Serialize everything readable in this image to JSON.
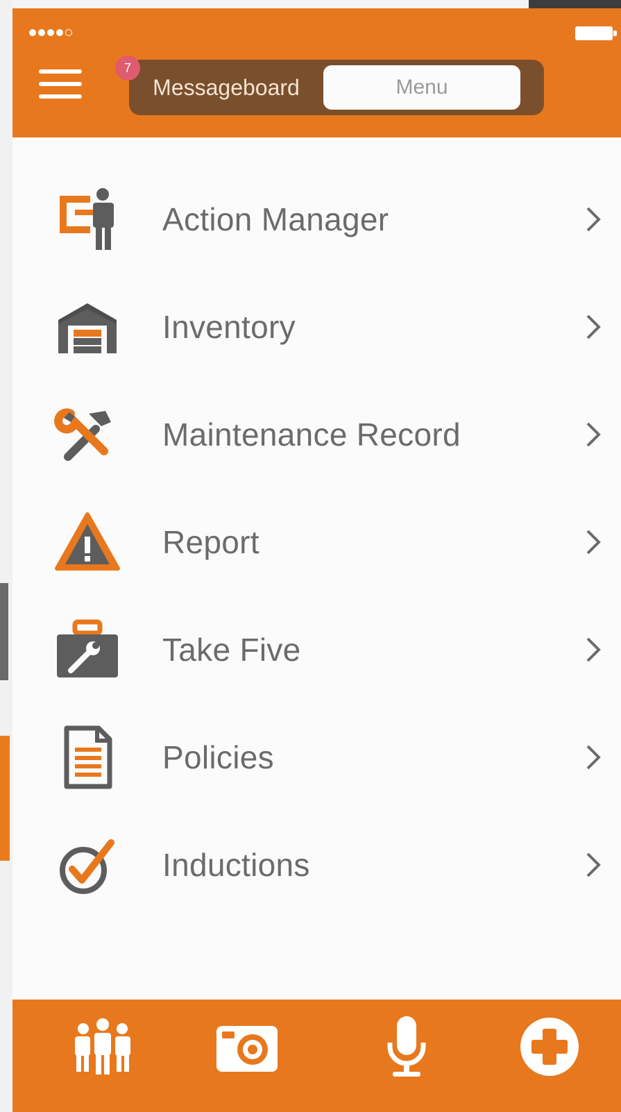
{
  "status_bar": {
    "icons": [
      "signal-dots-icon",
      "battery-icon"
    ]
  },
  "header": {
    "menu_icon": "hamburger-icon",
    "badge_count": "7",
    "segments": {
      "left": "Messageboard",
      "right": "Menu"
    },
    "colors": {
      "bar": "#e8781d",
      "segment_track": "#7a4f2c",
      "badge": "#e05b6e"
    }
  },
  "menu": {
    "items": [
      {
        "label": "Action Manager",
        "icon": "action-manager-icon"
      },
      {
        "label": "Inventory",
        "icon": "warehouse-icon"
      },
      {
        "label": "Maintenance Record",
        "icon": "tools-icon"
      },
      {
        "label": "Report",
        "icon": "warning-triangle-icon"
      },
      {
        "label": "Take Five",
        "icon": "toolbox-icon"
      },
      {
        "label": "Policies",
        "icon": "document-icon"
      },
      {
        "label": "Inductions",
        "icon": "checkmark-circle-icon"
      }
    ],
    "colors": {
      "icon_grey": "#5d5d5d",
      "icon_orange": "#e8781d",
      "text": "#6b6b6b"
    }
  },
  "footer": {
    "icons": [
      "group-people-icon",
      "camera-icon",
      "microphone-icon",
      "add-circle-icon"
    ]
  }
}
